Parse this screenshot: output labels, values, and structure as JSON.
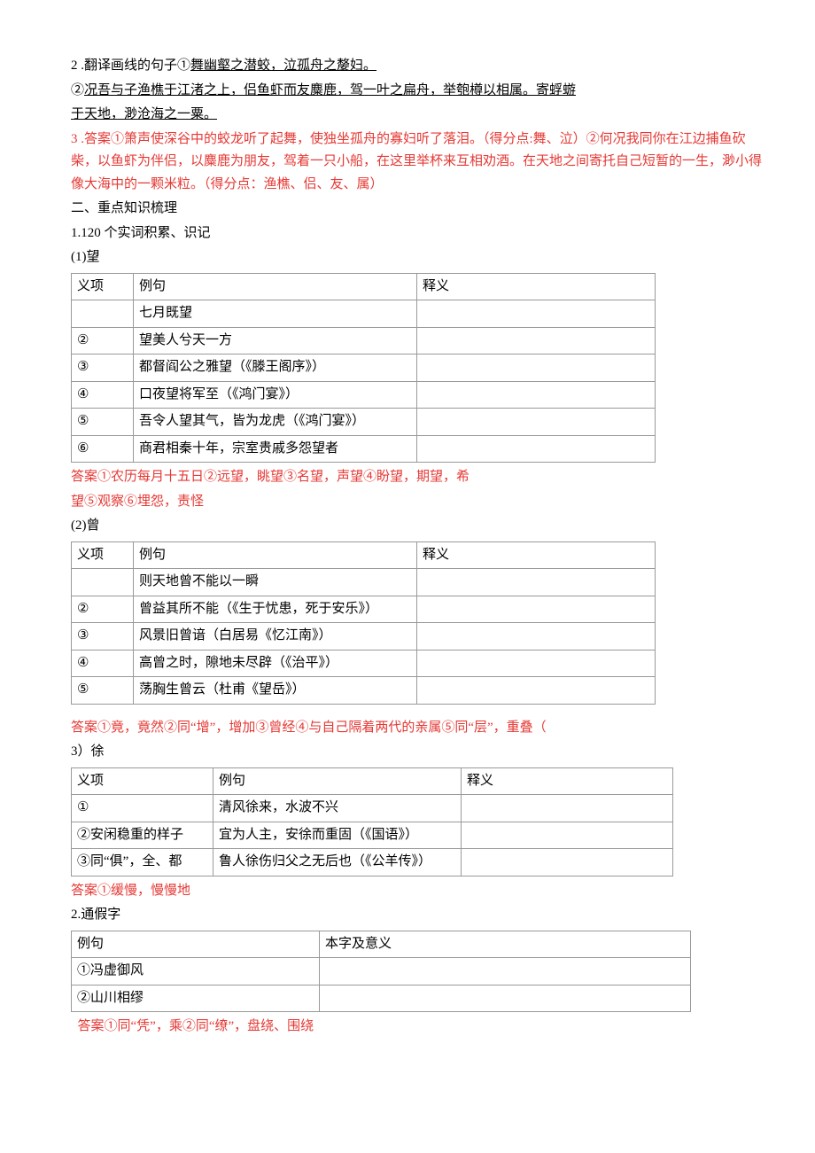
{
  "q2": {
    "label": "2 .翻译画线的句子①",
    "u1": "舞幽壑之潜蛟，泣孤舟之嫠妇。",
    "l2a": "②",
    "l2b": "况吾与子渔樵于江渚之上，侣鱼虾而友麋鹿，驾一叶之扁舟，举匏樽以相属。寄蜉蝣",
    "l2c": "于天地，渺沧海之一粟。"
  },
  "q3": {
    "label": "3 .答案①箫声使深谷中的蛟龙听了起舞，使独坐孤舟的寡妇听了落泪。（得分点:舞、泣）②何况我同你在江边捕鱼砍柴，以鱼虾为伴侣，以麋鹿为朋友，驾着一只小船，在这里举杯来互相劝酒。在天地之间寄托自己短暂的一生，渺小得像大海中的一颗米粒。（得分点：渔樵、侣、友、属）"
  },
  "sec2": {
    "h": "二、重点知识梳理",
    "h1": "1.120 个实词积累、识记"
  },
  "wang": {
    "title": "(1)望",
    "head": [
      "义项",
      "例句",
      "释义"
    ],
    "rows": [
      [
        "",
        "七月既望",
        ""
      ],
      [
        "②",
        "望美人兮天一方",
        ""
      ],
      [
        "③",
        "都督阎公之雅望（《滕王阁序》）",
        ""
      ],
      [
        "④",
        "口夜望将军至（《鸿门宴》）",
        ""
      ],
      [
        "⑤",
        "吾令人望其气，皆为龙虎（《鸿门宴》）",
        ""
      ],
      [
        "⑥",
        "商君相秦十年，宗室贵戚多怨望者",
        ""
      ]
    ],
    "ans1": "答案①农历每月十五日②远望，眺望③名望，声望④盼望，期望，希",
    "ans2": "望⑤观察⑥埋怨，责怪"
  },
  "ceng": {
    "title": "(2)曾",
    "head": [
      "义项",
      "例句",
      "释义"
    ],
    "rows": [
      [
        "",
        "则天地曾不能以一瞬",
        ""
      ],
      [
        "②",
        "曾益其所不能（《生于忧患，死于安乐》）",
        ""
      ],
      [
        "③",
        "风景旧曾谙（白居易《忆江南》）",
        ""
      ],
      [
        "④",
        "高曾之时，隙地未尽辟（《治平》）",
        ""
      ],
      [
        "⑤",
        "荡胸生曾云（杜甫《望岳》）",
        ""
      ]
    ],
    "ans": "答案①竟，竟然②同“增”，增加③曾经④与自己隔着两代的亲属⑤同“层”，重叠（"
  },
  "xu": {
    "title": "3）徐",
    "head": [
      "义项",
      "例句",
      "释义"
    ],
    "rows": [
      [
        "①",
        "清风徐来，水波不兴",
        ""
      ],
      [
        "②安闲稳重的样子",
        "宜为人主，安徐而重固（《国语》）",
        ""
      ],
      [
        "③同“俱”，全、都",
        "鲁人徐伤归父之无后也（《公羊传》）",
        ""
      ]
    ],
    "ans": "答案①缓慢，慢慢地"
  },
  "tongjia": {
    "title": "2.通假字",
    "head": [
      "例句",
      "本字及意义"
    ],
    "rows": [
      [
        "①冯虚御风",
        ""
      ],
      [
        "②山川相缪",
        ""
      ]
    ],
    "ans": "  答案①同“凭”，乘②同“缭”，盘绕、围绕"
  }
}
